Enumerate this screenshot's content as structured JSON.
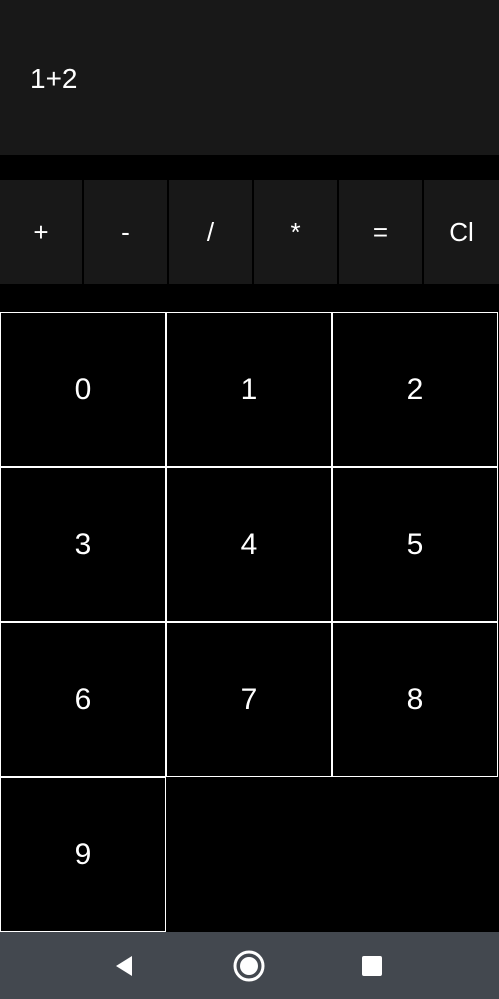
{
  "display": {
    "expression": "1+2"
  },
  "operators": [
    {
      "label": "+",
      "name": "plus-button"
    },
    {
      "label": "-",
      "name": "minus-button"
    },
    {
      "label": "/",
      "name": "divide-button"
    },
    {
      "label": "*",
      "name": "multiply-button"
    },
    {
      "label": "=",
      "name": "equals-button"
    },
    {
      "label": "Cl",
      "name": "clear-button"
    }
  ],
  "digits": [
    "0",
    "1",
    "2",
    "3",
    "4",
    "5",
    "6",
    "7",
    "8",
    "9"
  ],
  "navbar": {
    "back_icon": "back-triangle-icon",
    "home_icon": "home-circle-icon",
    "recents_icon": "recents-square-icon"
  },
  "colors": {
    "background": "#000000",
    "panel": "#181818",
    "key_border": "#ffffff",
    "navbar": "#43484f"
  }
}
